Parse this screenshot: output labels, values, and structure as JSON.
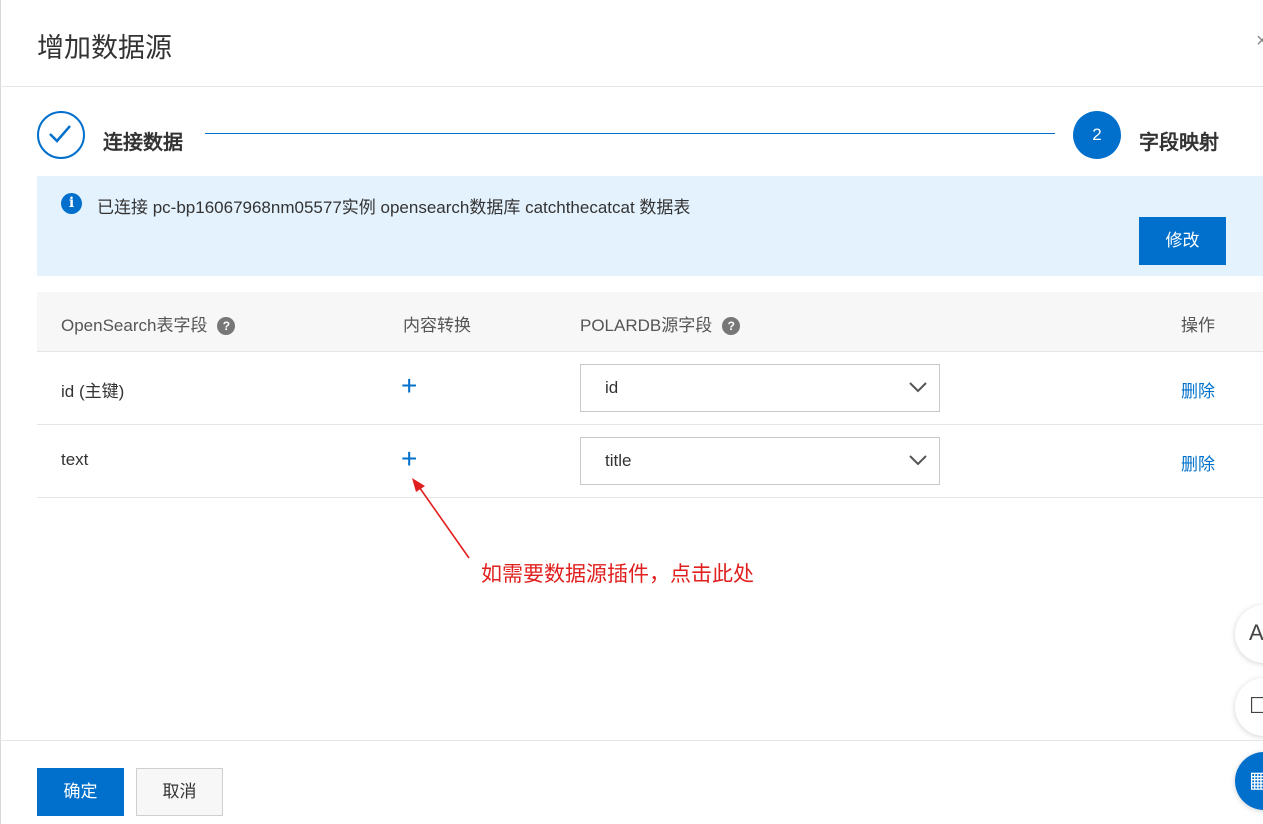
{
  "dialog": {
    "title": "增加数据源"
  },
  "steps": [
    {
      "label": "连接数据",
      "status": "done"
    },
    {
      "number": "2",
      "label": "字段映射",
      "status": "active"
    }
  ],
  "banner": {
    "text": "已连接 pc-bp16067968nm05577实例 opensearch数据库 catchthecatcat 数据表",
    "button_label": "修改",
    "icon": "info-icon"
  },
  "table": {
    "headers": {
      "opensearch_field": "OpenSearch表字段",
      "content_convert": "内容转换",
      "source_field": "POLARDB源字段",
      "action": "操作"
    },
    "rows": [
      {
        "field": "id (主键)",
        "source": "id",
        "action": "删除"
      },
      {
        "field": "text",
        "source": "title",
        "action": "删除"
      }
    ]
  },
  "annotation": {
    "text": "如需要数据源插件，点击此处",
    "color": "#e0201e"
  },
  "footer": {
    "ok_label": "确定",
    "cancel_label": "取消"
  },
  "colors": {
    "primary": "#0070cc",
    "banner_bg": "#e4f2fd"
  }
}
